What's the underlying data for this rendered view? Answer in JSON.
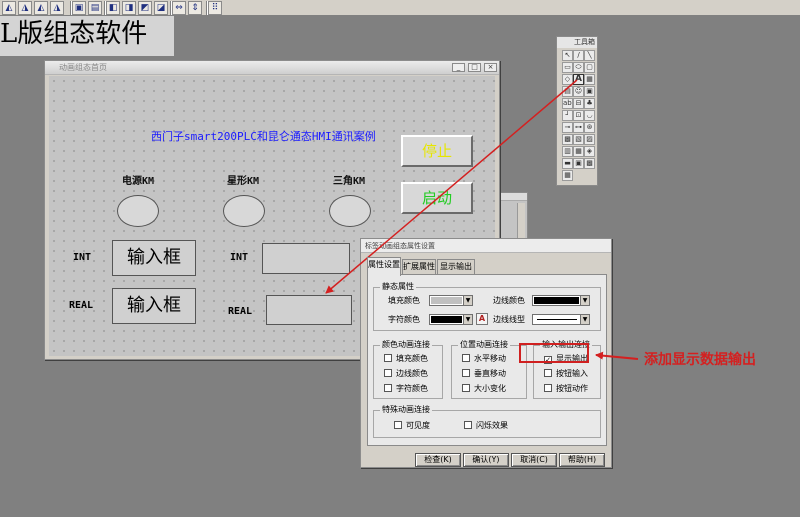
{
  "banner": {
    "text": "L版组态软件"
  },
  "canvas_window": {
    "title": "动画组态首页",
    "headline": "西门子smart200PLC和昆仑通态HMI通讯案例",
    "lamps": [
      {
        "label": "电源KM"
      },
      {
        "label": "星形KM"
      },
      {
        "label": "三角KM"
      }
    ],
    "buttons": {
      "stop": "停止",
      "start": "启动"
    },
    "inputs": [
      {
        "side_label": "INT",
        "box_text": "输入框"
      },
      {
        "side_label": "REAL",
        "box_text": "输入框"
      }
    ],
    "outputs": [
      {
        "side_label": "INT"
      },
      {
        "side_label": "REAL"
      }
    ],
    "win_buttons": [
      "_",
      "□",
      "×"
    ]
  },
  "toolbox": {
    "title": "工具箱",
    "tool_rows": [
      [
        "↖",
        "/",
        "╲"
      ],
      [
        "▭",
        "⬭",
        "▢"
      ],
      [
        "◇",
        "A",
        "▦"
      ],
      [
        "▤",
        "☺",
        "▣"
      ],
      [
        "abl",
        "⊟",
        "♣"
      ],
      [
        "┘",
        "⊡",
        "◡"
      ],
      [
        "⊸",
        "⊶",
        "⊛"
      ],
      [
        "▩",
        "▧",
        "▨"
      ],
      [
        "▥",
        "▦",
        "◈"
      ],
      [
        "▬",
        "▣",
        "▩"
      ],
      [
        "▦",
        "",
        ""
      ]
    ]
  },
  "dialog": {
    "title": "标签动画组态属性设置",
    "tabs": [
      "属性设置",
      "扩展属性",
      "显示输出"
    ],
    "static_group": {
      "title": "静态属性",
      "fill_color_label": "填充颜色",
      "border_color_label": "边线颜色",
      "font_color_label": "字符颜色",
      "border_style_label": "边线线型",
      "fill_color": "#c0c0c0",
      "border_color": "#000000",
      "font_color": "#000000"
    },
    "color_group": {
      "title": "颜色动画连接",
      "items": [
        {
          "label": "填充颜色",
          "checked": false
        },
        {
          "label": "边线颜色",
          "checked": false
        },
        {
          "label": "字符颜色",
          "checked": false
        }
      ]
    },
    "position_group": {
      "title": "位置动画连接",
      "items": [
        {
          "label": "水平移动",
          "checked": false
        },
        {
          "label": "垂直移动",
          "checked": false
        },
        {
          "label": "大小变化",
          "checked": false
        }
      ]
    },
    "io_group": {
      "title": "输入输出连接",
      "items": [
        {
          "label": "显示输出",
          "checked": true,
          "mark": "✓"
        },
        {
          "label": "按钮输入",
          "checked": false,
          "mark": ""
        },
        {
          "label": "按钮动作",
          "checked": false,
          "mark": ""
        }
      ]
    },
    "special_group": {
      "title": "特殊动画连接",
      "items": [
        {
          "label": "可见度",
          "checked": false
        },
        {
          "label": "闪烁效果",
          "checked": false
        }
      ]
    },
    "buttons": {
      "check": "检查(K)",
      "ok": "确认(Y)",
      "cancel": "取消(C)",
      "help": "帮助(H)"
    }
  },
  "annotation": {
    "text": "添加显示数据输出",
    "color": "#d42020"
  }
}
